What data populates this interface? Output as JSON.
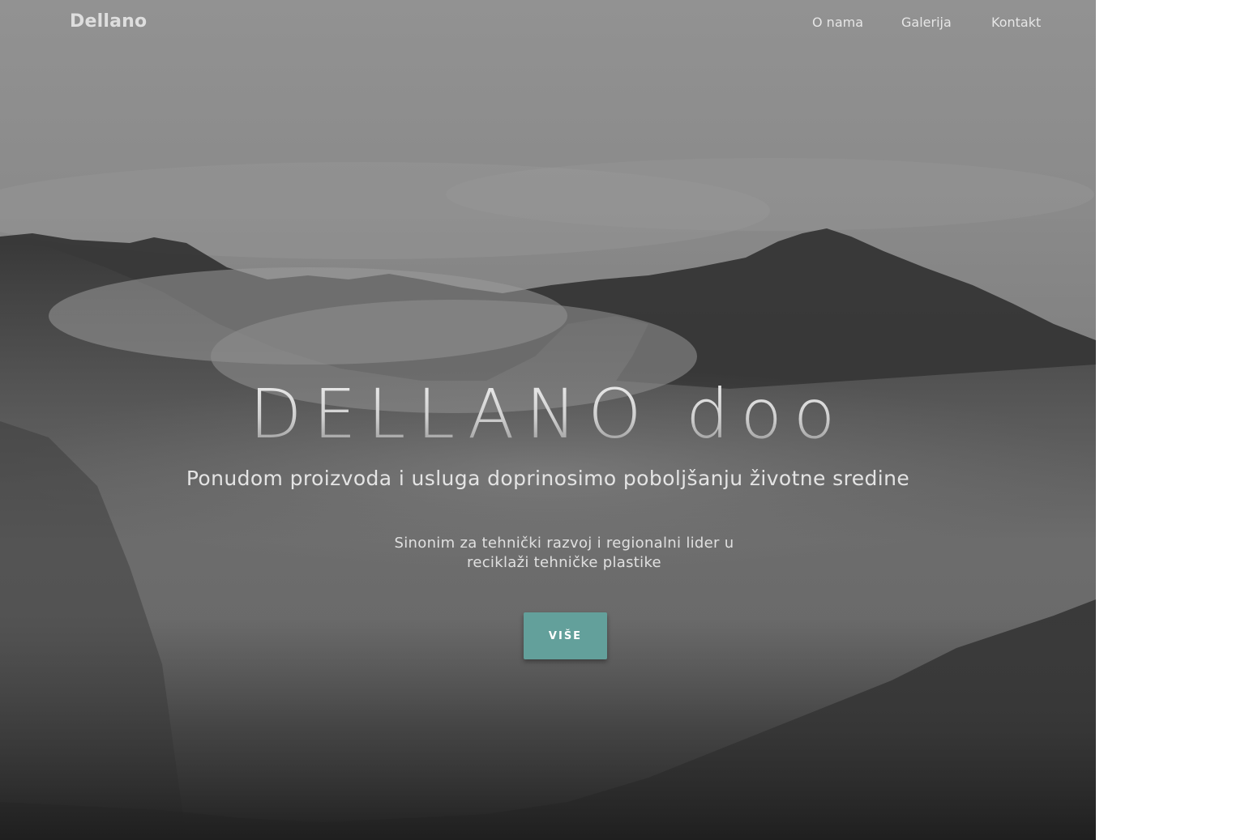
{
  "navbar": {
    "brand": "Dellano",
    "links": [
      {
        "label": "O nama"
      },
      {
        "label": "Galerija"
      },
      {
        "label": "Kontakt"
      }
    ]
  },
  "hero": {
    "title": "DELLANO doo",
    "subtitle": "Ponudom proizvoda i usluga doprinosimo poboljšanju životne sredine",
    "description": "Sinonim za tehnički razvoj i regionalni lider u reciklaži tehničke plastike",
    "button_label": "VIŠE"
  },
  "colors": {
    "accent": "#63a09b",
    "hero_background": "#7a7a7a"
  }
}
